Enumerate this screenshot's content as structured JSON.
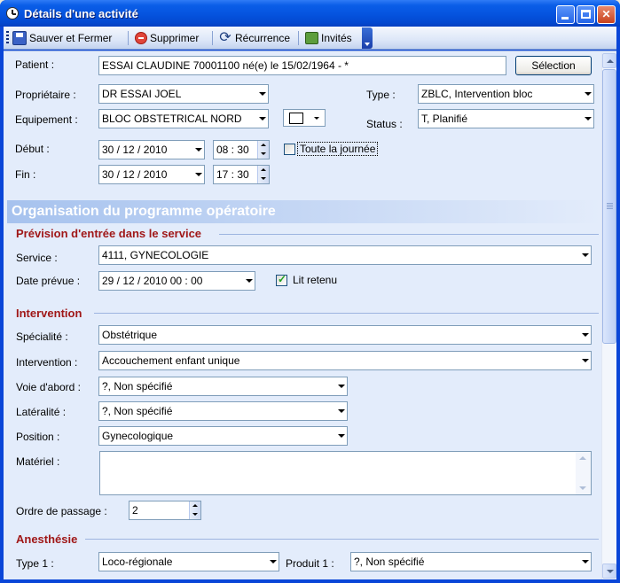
{
  "window": {
    "title": "Détails d'une activité"
  },
  "toolbar": {
    "save_label": "Sauver et Fermer",
    "delete_label": "Supprimer",
    "recurrence_label": "Récurrence",
    "guests_label": "Invités"
  },
  "form": {
    "patient_label": "Patient :",
    "patient_value": "ESSAI CLAUDINE 70001100 né(e) le 15/02/1964 - *",
    "selection_button": "Sélection",
    "owner_label": "Propriétaire :",
    "owner_value": "DR ESSAI JOEL",
    "type_label": "Type :",
    "type_value": "ZBLC, Intervention bloc",
    "equipment_label": "Equipement :",
    "equipment_value": "BLOC OBSTETRICAL NORD",
    "status_label": "Status :",
    "status_value": "T, Planifié",
    "start_label": "Début :",
    "start_date": "30 / 12 / 2010",
    "start_time": "08 : 30",
    "all_day_label": "Toute la journée",
    "end_label": "Fin :",
    "end_date": "30 / 12 / 2010",
    "end_time": "17 : 30"
  },
  "banner": {
    "title": "Organisation du programme opératoire"
  },
  "admission": {
    "section_title": "Prévision d'entrée dans le service",
    "service_label": "Service :",
    "service_value": "4111, GYNECOLOGIE",
    "planned_date_label": "Date prévue :",
    "planned_date_value": "29 / 12 / 2010   00 : 00",
    "bed_label": "Lit retenu",
    "bed_checked": true
  },
  "intervention": {
    "section_title": "Intervention",
    "specialty_label": "Spécialité :",
    "specialty_value": "Obstétrique",
    "intervention_label": "Intervention :",
    "intervention_value": "Accouchement enfant unique",
    "approach_label": "Voie d'abord :",
    "approach_value": "?, Non spécifié",
    "laterality_label": "Latéralité :",
    "laterality_value": "?, Non spécifié",
    "position_label": "Position :",
    "position_value": "Gynecologique",
    "material_label": "Matériel :",
    "material_value": "",
    "order_label": "Ordre de passage :",
    "order_value": "2"
  },
  "anesthesia": {
    "section_title": "Anesthésie",
    "type1_label": "Type 1 :",
    "type1_value": "Loco-régionale",
    "product1_label": "Produit 1 :",
    "product1_value": "?, Non spécifié"
  }
}
